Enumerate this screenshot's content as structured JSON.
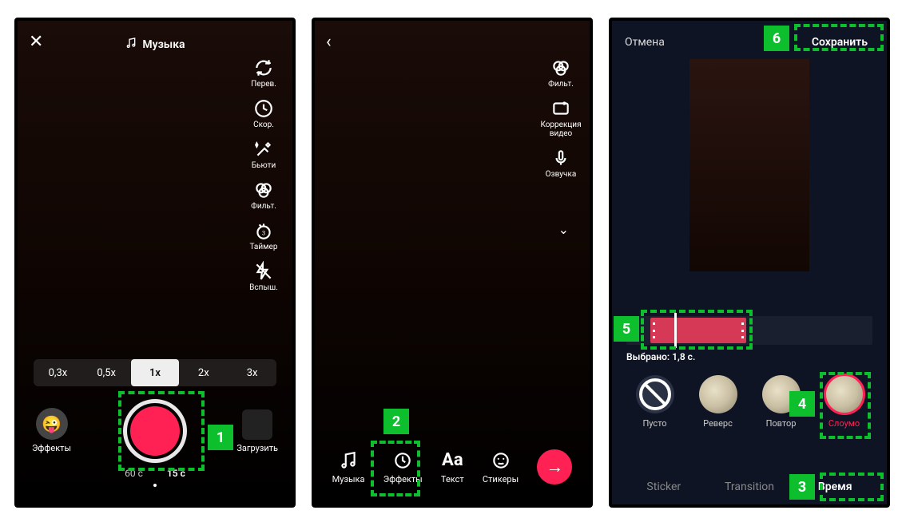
{
  "phone1": {
    "music_label": "Музыка",
    "tools": {
      "flip": "Перев.",
      "speed": "Скор.",
      "beauty": "Бьюти",
      "filters": "Фильт.",
      "timer": "Таймер",
      "flash": "Вспыш."
    },
    "speeds": [
      "0,3x",
      "0,5x",
      "1x",
      "2x",
      "3x"
    ],
    "speed_active_index": 2,
    "effects_label": "Эффекты",
    "upload_label": "Загрузить",
    "durations": [
      "60 с",
      "15 с"
    ],
    "duration_active_index": 1
  },
  "phone2": {
    "tools": {
      "filters": "Фильт.",
      "correction": "Коррекция видео",
      "voice": "Озвучка"
    },
    "bottom": {
      "music": "Музыка",
      "effects": "Эффекты",
      "text": "Текст",
      "stickers": "Стикеры"
    }
  },
  "phone3": {
    "cancel": "Отмена",
    "save": "Сохранить",
    "selected_label": "Выбрано: 1,8 с.",
    "fx": {
      "none": "Пусто",
      "reverse": "Реверс",
      "repeat": "Повтор",
      "slowmo": "Слоумо"
    },
    "fx_active": "slowmo",
    "tabs": {
      "sticker": "Sticker",
      "transition": "Transition",
      "time": "Время"
    },
    "tab_active": "time"
  },
  "badges": [
    "1",
    "2",
    "3",
    "4",
    "5",
    "6"
  ]
}
